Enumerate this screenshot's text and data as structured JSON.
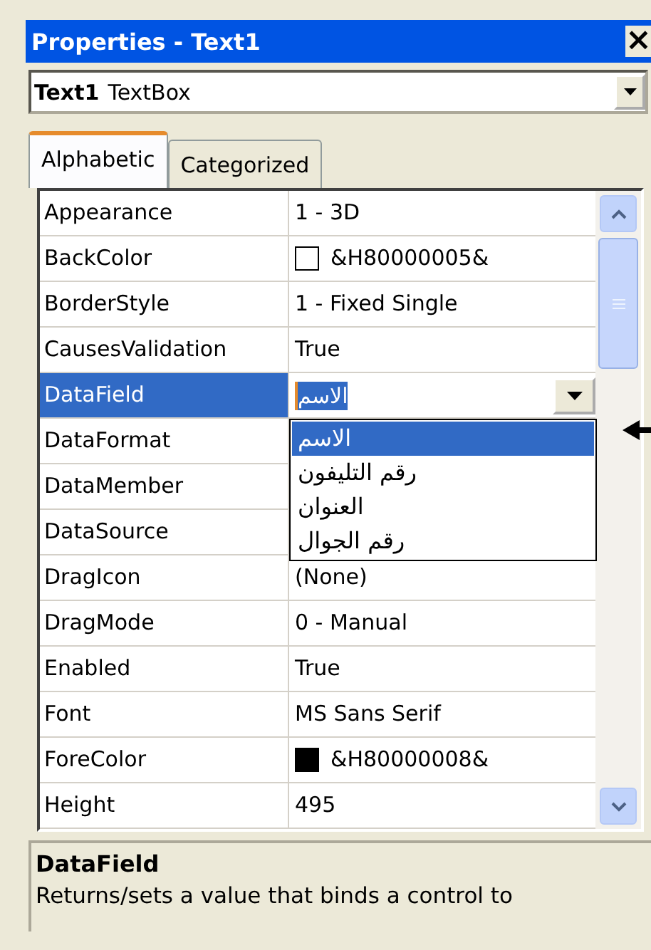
{
  "window": {
    "title": "Properties - Text1",
    "close_label": "×"
  },
  "object_selector": {
    "name": "Text1",
    "type": "TextBox"
  },
  "tabs": [
    {
      "label": "Alphabetic",
      "selected": true
    },
    {
      "label": "Categorized",
      "selected": false
    }
  ],
  "properties": [
    {
      "name": "Appearance",
      "value": "1 - 3D",
      "selected": false
    },
    {
      "name": "BackColor",
      "value": "&H80000005&",
      "color": "#ffffff",
      "selected": false
    },
    {
      "name": "BorderStyle",
      "value": "1 - Fixed Single",
      "selected": false
    },
    {
      "name": "CausesValidation",
      "value": "True",
      "selected": false
    },
    {
      "name": "DataField",
      "value": "الاسم",
      "selected": true
    },
    {
      "name": "DataFormat",
      "selected": false
    },
    {
      "name": "DataMember",
      "selected": false
    },
    {
      "name": "DataSource",
      "selected": false
    },
    {
      "name": "DragIcon",
      "value": "(None)",
      "selected": false
    },
    {
      "name": "DragMode",
      "value": "0 - Manual",
      "selected": false
    },
    {
      "name": "Enabled",
      "value": "True",
      "selected": false
    },
    {
      "name": "Font",
      "value": "MS Sans Serif",
      "selected": false
    },
    {
      "name": "ForeColor",
      "value": "&H80000008&",
      "color": "#000000",
      "selected": false
    },
    {
      "name": "Height",
      "value": "495",
      "selected": false
    }
  ],
  "dropdown": {
    "options": [
      {
        "label": "الاسم",
        "selected": true
      },
      {
        "label": "رقم التليفون",
        "selected": false
      },
      {
        "label": "العنوان",
        "selected": false
      },
      {
        "label": "رقم الجوال",
        "selected": false
      }
    ]
  },
  "description": {
    "title": "DataField",
    "text": "Returns/sets a value that binds a control to"
  }
}
